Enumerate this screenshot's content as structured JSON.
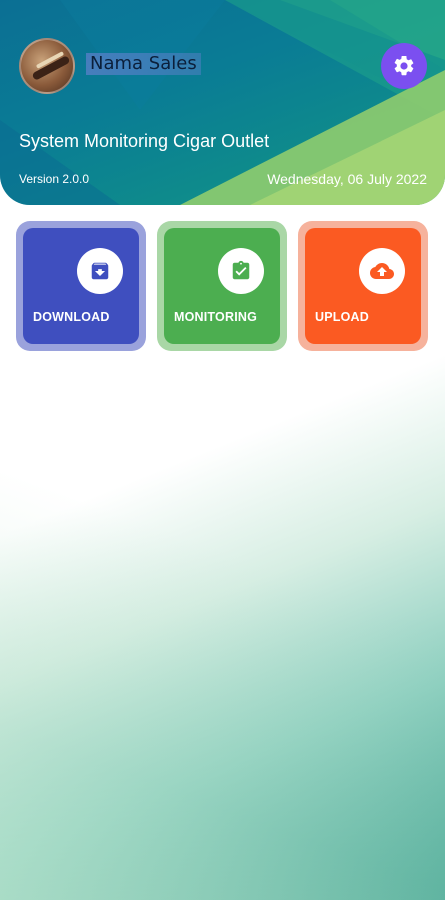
{
  "header": {
    "user_name": "Nama Sales",
    "app_title": "System Monitoring Cigar Outlet",
    "version": "Version 2.0.0",
    "date": "Wednesday, 06 July 2022",
    "settings_icon": "gear-icon"
  },
  "tiles": [
    {
      "label": "DOWNLOAD",
      "icon": "archive-download-icon",
      "color": "#3f4fbf"
    },
    {
      "label": "MONITORING",
      "icon": "clipboard-check-icon",
      "color": "#4cae50"
    },
    {
      "label": "UPLOAD",
      "icon": "cloud-upload-icon",
      "color": "#fb5a22"
    }
  ],
  "colors": {
    "header": "#0b7394",
    "accent": "#7b4ff0"
  }
}
